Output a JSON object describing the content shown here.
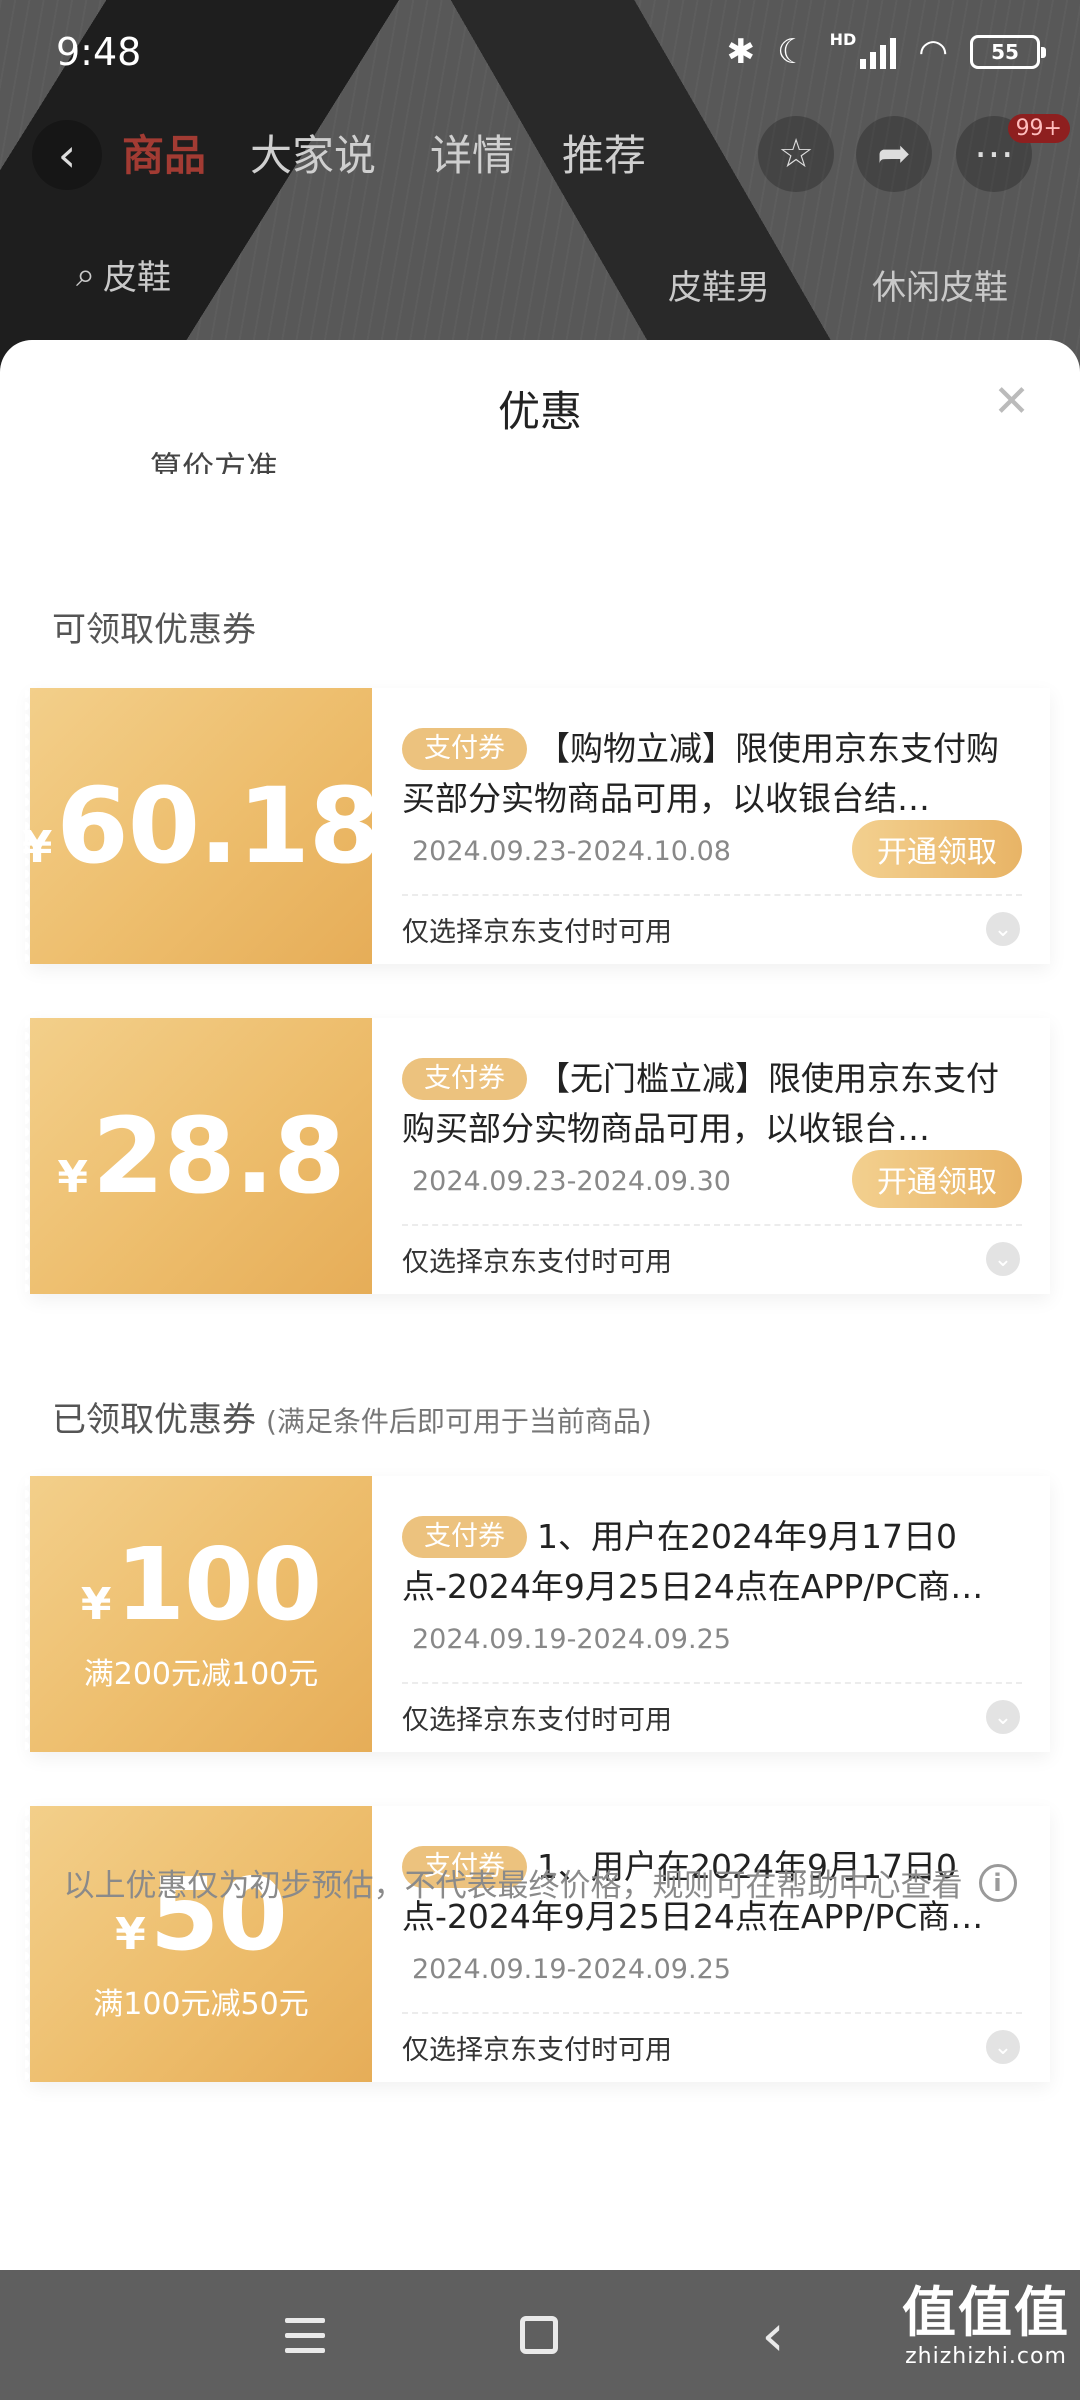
{
  "status_bar": {
    "time": "9:48",
    "battery": "55",
    "network_label": "HD",
    "icons": [
      "bluetooth-icon",
      "moon-icon",
      "signal-icon",
      "wifi-icon",
      "battery-icon"
    ]
  },
  "product_nav": {
    "tabs": [
      "商品",
      "大家说",
      "详情",
      "推荐"
    ],
    "active_tab": "商品",
    "badge": "99+"
  },
  "search": {
    "query": "皮鞋",
    "chips": [
      "皮鞋男",
      "休闲皮鞋"
    ]
  },
  "sheet": {
    "title": "优惠",
    "cut_text": "算价方准",
    "available_section": "可领取优惠券",
    "claimed_section": "已领取优惠券",
    "claimed_section_sub": "(满足条件后即可用于当前商品)",
    "footer_note": "以上优惠仅为初步预估，不代表最终价格，规则可在帮助中心查看",
    "available": [
      {
        "currency": "¥",
        "amount": "60.18",
        "tag": "支付券",
        "description": "【购物立减】限使用京东支付购买部分实物商品可用，以收银台结…",
        "date": "2024.09.23-2024.10.08",
        "button": "开通领取",
        "note": "仅选择京东支付时可用"
      },
      {
        "currency": "¥",
        "amount": "28.8",
        "tag": "支付券",
        "description": "【无门槛立减】限使用京东支付购买部分实物商品可用，以收银台…",
        "date": "2024.09.23-2024.09.30",
        "button": "开通领取",
        "note": "仅选择京东支付时可用"
      }
    ],
    "claimed": [
      {
        "currency": "¥",
        "amount": "100",
        "condition": "满200元减100元",
        "tag": "支付券",
        "description": "1、用户在2024年9月17日0点-2024年9月25日24点在APP/PC商…",
        "date": "2024.09.19-2024.09.25",
        "note": "仅选择京东支付时可用"
      },
      {
        "currency": "¥",
        "amount": "50",
        "condition": "满100元减50元",
        "tag": "支付券",
        "description": "1、用户在2024年9月17日0点-2024年9月25日24点在APP/PC商…",
        "date": "2024.09.19-2024.09.25",
        "note": "仅选择京东支付时可用"
      }
    ]
  },
  "watermark": {
    "main": "值值值",
    "sub": "zhizhizhi.com"
  },
  "colors": {
    "coupon_gold": "#edbd6c",
    "tag_gold": "#ecc27e",
    "active_tab": "#a23b33"
  }
}
